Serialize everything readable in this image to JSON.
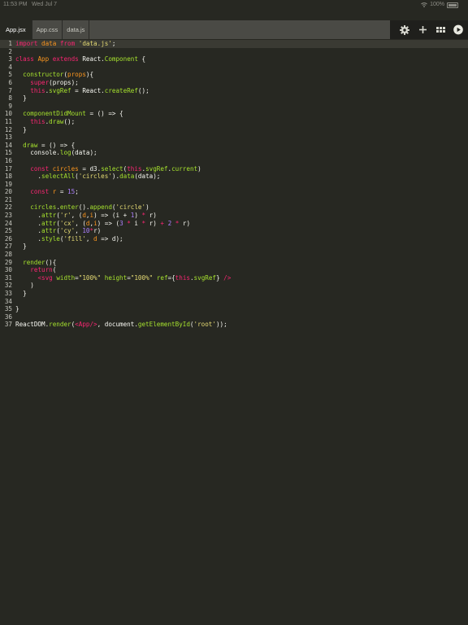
{
  "status_bar": {
    "time": "11:53 PM",
    "date": "Wed Jul 7",
    "battery": "100%"
  },
  "tabs": [
    {
      "label": "App.jsx",
      "active": true
    },
    {
      "label": "App.css",
      "active": false
    },
    {
      "label": "data.js",
      "active": false
    }
  ],
  "toolbar_icons": [
    "gear-icon",
    "plus-icon",
    "grid-icon",
    "play-icon"
  ],
  "code_lines": [
    {
      "n": "1",
      "t": [
        [
          "kw",
          "import"
        ],
        [
          "p",
          " "
        ],
        [
          "prm",
          "data"
        ],
        [
          "p",
          " "
        ],
        [
          "kw",
          "from"
        ],
        [
          "p",
          " "
        ],
        [
          "str",
          "'data.js'"
        ],
        [
          "p",
          ";"
        ]
      ],
      "current": true
    },
    {
      "n": "2",
      "t": []
    },
    {
      "n": "3",
      "t": [
        [
          "kw",
          "class"
        ],
        [
          "p",
          " "
        ],
        [
          "prm",
          "App"
        ],
        [
          "p",
          " "
        ],
        [
          "kw",
          "extends"
        ],
        [
          "p",
          " React."
        ],
        [
          "fn",
          "Component"
        ],
        [
          "p",
          " {"
        ]
      ]
    },
    {
      "n": "4",
      "t": []
    },
    {
      "n": "5",
      "t": [
        [
          "p",
          "  "
        ],
        [
          "fn",
          "constructor"
        ],
        [
          "p",
          "("
        ],
        [
          "prm",
          "props"
        ],
        [
          "p",
          "){"
        ]
      ]
    },
    {
      "n": "6",
      "t": [
        [
          "p",
          "    "
        ],
        [
          "kw",
          "super"
        ],
        [
          "p",
          "(props);"
        ]
      ]
    },
    {
      "n": "7",
      "t": [
        [
          "p",
          "    "
        ],
        [
          "kw",
          "this"
        ],
        [
          "p",
          "."
        ],
        [
          "fn",
          "svgRef"
        ],
        [
          "p",
          " = React."
        ],
        [
          "fn",
          "createRef"
        ],
        [
          "p",
          "();"
        ]
      ]
    },
    {
      "n": "8",
      "t": [
        [
          "p",
          "  }"
        ]
      ]
    },
    {
      "n": "9",
      "t": []
    },
    {
      "n": "10",
      "t": [
        [
          "p",
          "  "
        ],
        [
          "fn",
          "componentDidMount"
        ],
        [
          "p",
          " = () => {"
        ]
      ]
    },
    {
      "n": "11",
      "t": [
        [
          "p",
          "    "
        ],
        [
          "kw",
          "this"
        ],
        [
          "p",
          "."
        ],
        [
          "fn",
          "draw"
        ],
        [
          "p",
          "();"
        ]
      ]
    },
    {
      "n": "12",
      "t": [
        [
          "p",
          "  }"
        ]
      ]
    },
    {
      "n": "13",
      "t": []
    },
    {
      "n": "14",
      "t": [
        [
          "p",
          "  "
        ],
        [
          "fn",
          "draw"
        ],
        [
          "p",
          " = () => {"
        ]
      ]
    },
    {
      "n": "15",
      "t": [
        [
          "p",
          "    console."
        ],
        [
          "fn",
          "log"
        ],
        [
          "p",
          "(data);"
        ]
      ]
    },
    {
      "n": "16",
      "t": []
    },
    {
      "n": "17",
      "t": [
        [
          "p",
          "    "
        ],
        [
          "kw",
          "const"
        ],
        [
          "p",
          " "
        ],
        [
          "prm",
          "circles"
        ],
        [
          "p",
          " = d3."
        ],
        [
          "fn",
          "select"
        ],
        [
          "p",
          "("
        ],
        [
          "kw",
          "this"
        ],
        [
          "p",
          "."
        ],
        [
          "fn",
          "svgRef"
        ],
        [
          "p",
          "."
        ],
        [
          "fn",
          "current"
        ],
        [
          "p",
          ")"
        ]
      ]
    },
    {
      "n": "18",
      "t": [
        [
          "p",
          "      ."
        ],
        [
          "fn",
          "selectAll"
        ],
        [
          "p",
          "("
        ],
        [
          "str",
          "'circles'"
        ],
        [
          "p",
          ")."
        ],
        [
          "fn",
          "data"
        ],
        [
          "p",
          "(data);"
        ]
      ]
    },
    {
      "n": "19",
      "t": []
    },
    {
      "n": "20",
      "t": [
        [
          "p",
          "    "
        ],
        [
          "kw",
          "const"
        ],
        [
          "p",
          " "
        ],
        [
          "prm",
          "r"
        ],
        [
          "p",
          " = "
        ],
        [
          "num",
          "15"
        ],
        [
          "p",
          ";"
        ]
      ]
    },
    {
      "n": "21",
      "t": []
    },
    {
      "n": "22",
      "t": [
        [
          "p",
          "    "
        ],
        [
          "fn",
          "circles"
        ],
        [
          "p",
          "."
        ],
        [
          "fn",
          "enter"
        ],
        [
          "p",
          "()."
        ],
        [
          "fn",
          "append"
        ],
        [
          "p",
          "("
        ],
        [
          "str",
          "'circle'"
        ],
        [
          "p",
          ")"
        ]
      ]
    },
    {
      "n": "23",
      "t": [
        [
          "p",
          "      ."
        ],
        [
          "fn",
          "attr"
        ],
        [
          "p",
          "("
        ],
        [
          "str",
          "'r'"
        ],
        [
          "p",
          ", ("
        ],
        [
          "prm",
          "d"
        ],
        [
          "p",
          ","
        ],
        [
          "prm",
          "i"
        ],
        [
          "p",
          ") => (i + "
        ],
        [
          "num",
          "1"
        ],
        [
          "p",
          ") "
        ],
        [
          "kw",
          "*"
        ],
        [
          "p",
          " r)"
        ]
      ]
    },
    {
      "n": "24",
      "t": [
        [
          "p",
          "      ."
        ],
        [
          "fn",
          "attr"
        ],
        [
          "p",
          "("
        ],
        [
          "str",
          "'cx'"
        ],
        [
          "p",
          ", ("
        ],
        [
          "prm",
          "d"
        ],
        [
          "p",
          ","
        ],
        [
          "prm",
          "i"
        ],
        [
          "p",
          ") => ("
        ],
        [
          "num",
          "3"
        ],
        [
          "p",
          " "
        ],
        [
          "kw",
          "*"
        ],
        [
          "p",
          " i "
        ],
        [
          "kw",
          "*"
        ],
        [
          "p",
          " r) "
        ],
        [
          "kw",
          "+"
        ],
        [
          "p",
          " "
        ],
        [
          "num",
          "2"
        ],
        [
          "p",
          " "
        ],
        [
          "kw",
          "*"
        ],
        [
          "p",
          " r)"
        ]
      ]
    },
    {
      "n": "25",
      "t": [
        [
          "p",
          "      ."
        ],
        [
          "fn",
          "attr"
        ],
        [
          "p",
          "("
        ],
        [
          "str",
          "'cy'"
        ],
        [
          "p",
          ", "
        ],
        [
          "num",
          "10"
        ],
        [
          "kw",
          "*"
        ],
        [
          "p",
          "r)"
        ]
      ]
    },
    {
      "n": "26",
      "t": [
        [
          "p",
          "      ."
        ],
        [
          "fn",
          "style"
        ],
        [
          "p",
          "("
        ],
        [
          "str",
          "'fill'"
        ],
        [
          "p",
          ", "
        ],
        [
          "prm",
          "d"
        ],
        [
          "p",
          " => d);"
        ]
      ]
    },
    {
      "n": "27",
      "t": [
        [
          "p",
          "  }"
        ]
      ]
    },
    {
      "n": "28",
      "t": []
    },
    {
      "n": "29",
      "t": [
        [
          "p",
          "  "
        ],
        [
          "fn",
          "render"
        ],
        [
          "p",
          "(){"
        ]
      ]
    },
    {
      "n": "30",
      "t": [
        [
          "p",
          "    "
        ],
        [
          "kw",
          "return"
        ],
        [
          "p",
          "("
        ]
      ]
    },
    {
      "n": "31",
      "t": [
        [
          "p",
          "      "
        ],
        [
          "kw",
          "<svg"
        ],
        [
          "p",
          " "
        ],
        [
          "fn",
          "width"
        ],
        [
          "p",
          "="
        ],
        [
          "str",
          "\"100%\""
        ],
        [
          "p",
          " "
        ],
        [
          "fn",
          "height"
        ],
        [
          "p",
          "="
        ],
        [
          "str",
          "\"100%\""
        ],
        [
          "p",
          " "
        ],
        [
          "fn",
          "ref"
        ],
        [
          "p",
          "={"
        ],
        [
          "kw",
          "this"
        ],
        [
          "p",
          "."
        ],
        [
          "fn",
          "svgRef"
        ],
        [
          "p",
          "} "
        ],
        [
          "kw",
          "/>"
        ]
      ]
    },
    {
      "n": "32",
      "t": [
        [
          "p",
          "    )"
        ]
      ]
    },
    {
      "n": "33",
      "t": [
        [
          "p",
          "  }"
        ]
      ]
    },
    {
      "n": "34",
      "t": []
    },
    {
      "n": "35",
      "t": [
        [
          "p",
          "}"
        ]
      ]
    },
    {
      "n": "36",
      "t": []
    },
    {
      "n": "37",
      "t": [
        [
          "p",
          "ReactDOM."
        ],
        [
          "fn",
          "render"
        ],
        [
          "p",
          "("
        ],
        [
          "kw",
          "<App/>"
        ],
        [
          "p",
          ", document."
        ],
        [
          "fn",
          "getElementById"
        ],
        [
          "p",
          "("
        ],
        [
          "str",
          "'root'"
        ],
        [
          "p",
          "));"
        ]
      ]
    }
  ]
}
